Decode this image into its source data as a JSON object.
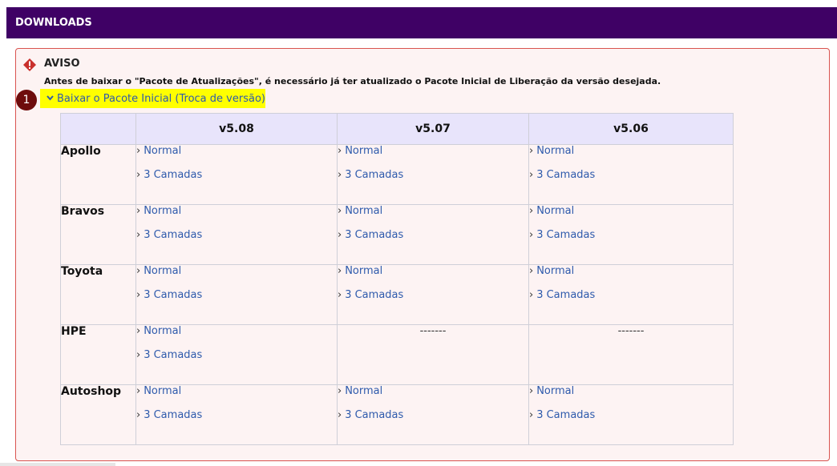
{
  "header": {
    "title": "DOWNLOADS"
  },
  "warning": {
    "title": "AVISO",
    "text": "Antes de baixar o \"Pacote de Atualizações\", é necessário já ter atualizado o Pacote Inicial de Liberação da versão desejada.",
    "icon": "warning-icon",
    "border_color": "#d9534f"
  },
  "step": {
    "number": "1"
  },
  "toggle": {
    "label": "Baixar o Pacote Inicial (Troca de versão)",
    "icon": "chevron-down-icon"
  },
  "table": {
    "columns": [
      "v5.08",
      "v5.07",
      "v5.06"
    ],
    "rows": [
      {
        "label": "Apollo",
        "cells": [
          [
            "Normal",
            "3 Camadas"
          ],
          [
            "Normal",
            "3 Camadas"
          ],
          [
            "Normal",
            "3 Camadas"
          ]
        ]
      },
      {
        "label": "Bravos",
        "cells": [
          [
            "Normal",
            "3 Camadas"
          ],
          [
            "Normal",
            "3 Camadas"
          ],
          [
            "Normal",
            "3 Camadas"
          ]
        ]
      },
      {
        "label": "Toyota",
        "cells": [
          [
            "Normal",
            "3 Camadas"
          ],
          [
            "Normal",
            "3 Camadas"
          ],
          [
            "Normal",
            "3 Camadas"
          ]
        ]
      },
      {
        "label": "HPE",
        "cells": [
          [
            "Normal",
            "3 Camadas"
          ],
          "-------",
          "-------"
        ]
      },
      {
        "label": "Autoshop",
        "cells": [
          [
            "Normal",
            "3 Camadas"
          ],
          [
            "Normal",
            "3 Camadas"
          ],
          [
            "Normal",
            "3 Camadas"
          ]
        ]
      }
    ]
  },
  "colors": {
    "header_bg": "#3f0165",
    "link": "#2e5aac",
    "highlight": "#ffff00",
    "panel_bg": "#fdf3f3",
    "table_header_bg": "#e8e4fb"
  }
}
